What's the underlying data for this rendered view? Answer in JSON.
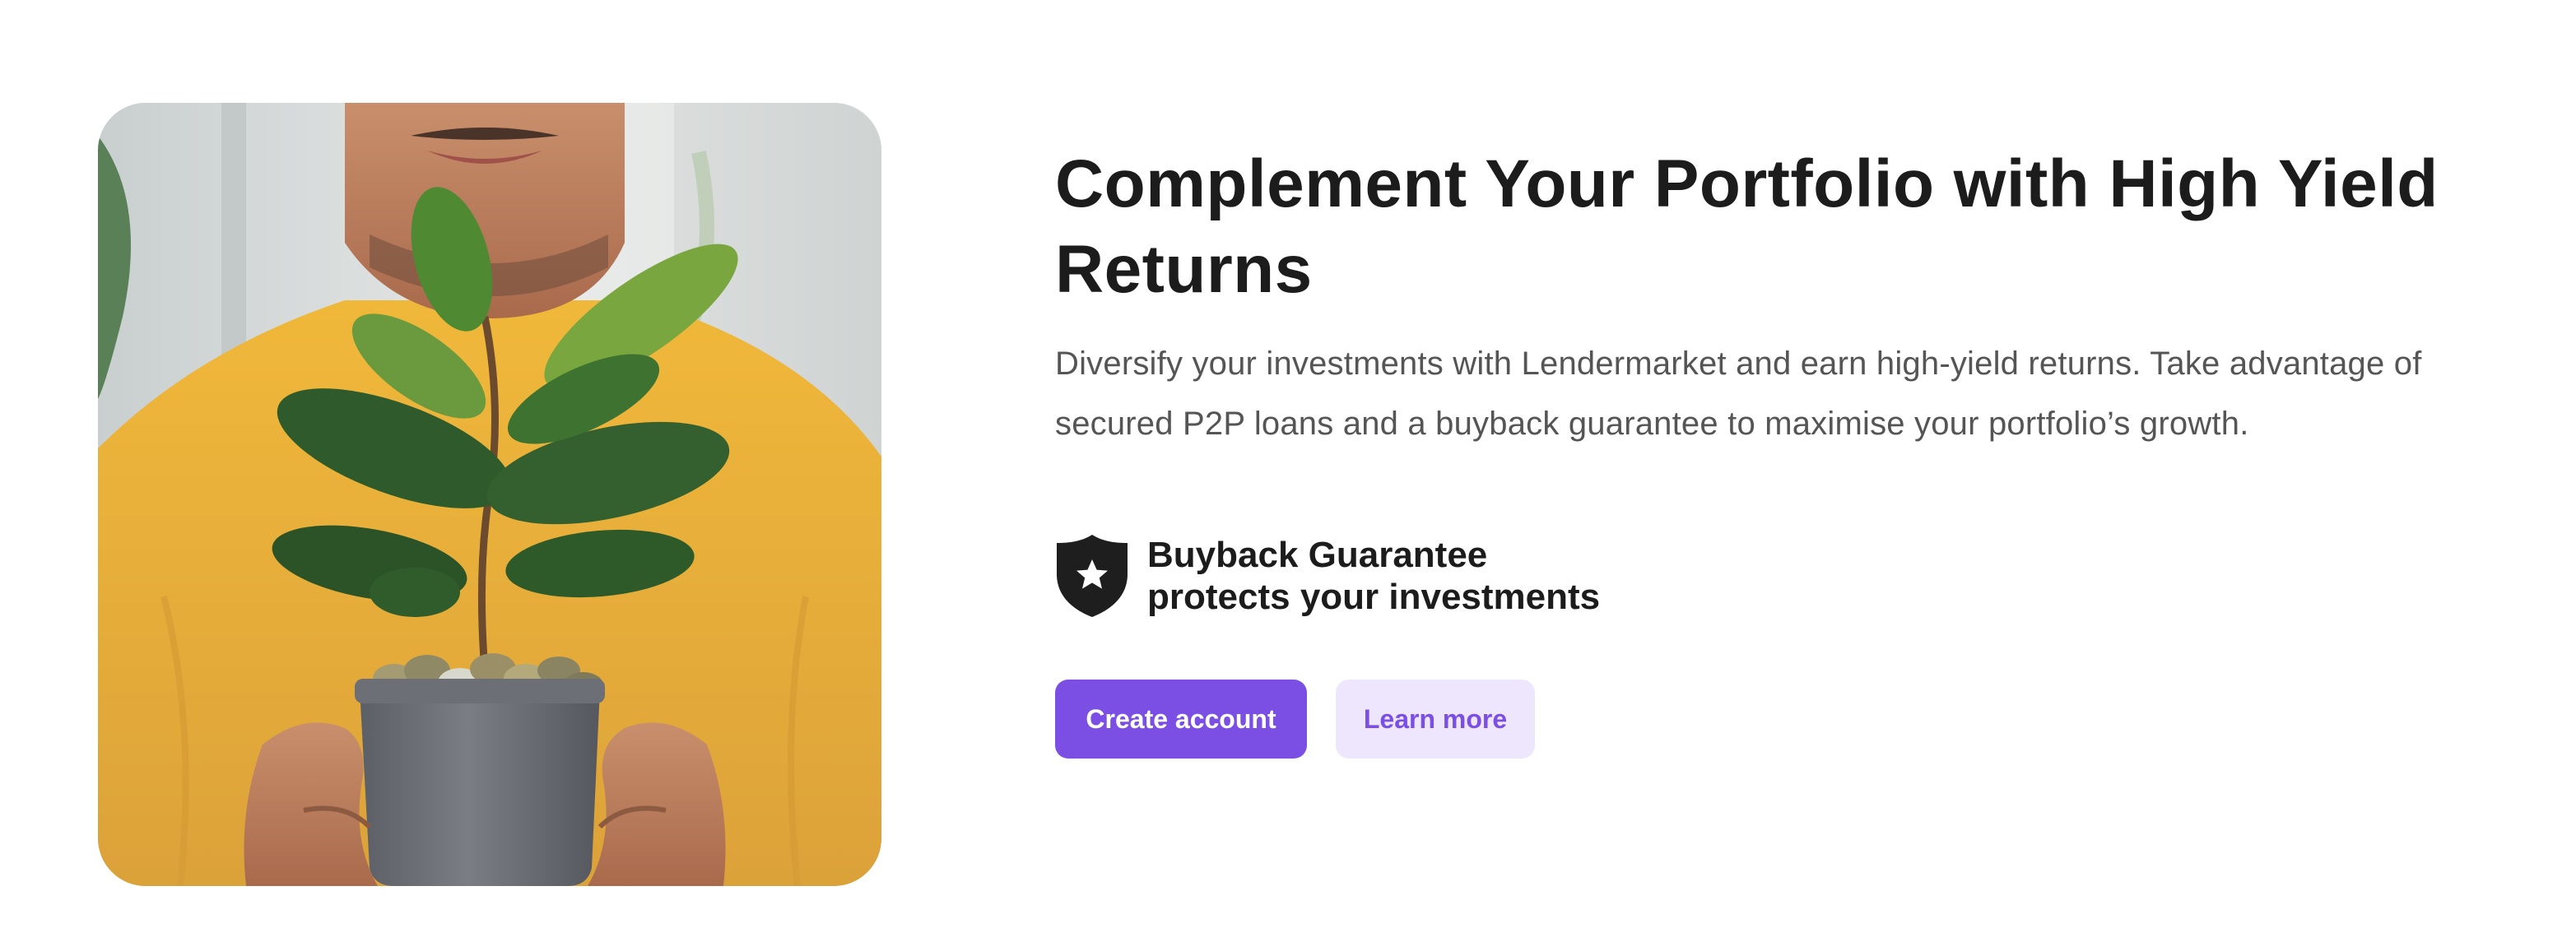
{
  "hero": {
    "image_alt": "Man in yellow sweater holding a potted plant growing from coins"
  },
  "content": {
    "headline": "Complement Your Portfolio with High Yield Returns",
    "description": "Diversify your investments with Lendermarket and earn high-yield returns. Take advantage of secured P2P loans and a buyback guarantee to maximise your portfolio’s growth."
  },
  "guarantee": {
    "icon": "shield-star-icon",
    "line1": "Buyback Guarantee",
    "line2": "protects your investments"
  },
  "buttons": {
    "primary_label": "Create account",
    "secondary_label": "Learn more"
  },
  "colors": {
    "accent": "#7b4fe4",
    "accent_light": "#ede6fc",
    "heading": "#1c1c1c",
    "body_text": "#555555"
  }
}
